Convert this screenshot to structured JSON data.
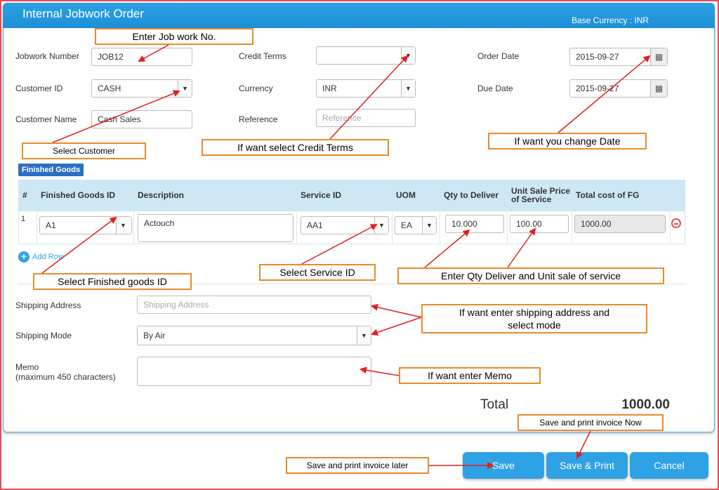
{
  "header": {
    "title": "Internal Jobwork Order",
    "base_currency": "Base Currency : INR"
  },
  "form": {
    "jobwork_number": {
      "label": "Jobwork Number",
      "value": "JOB12"
    },
    "customer_id": {
      "label": "Customer ID",
      "value": "CASH"
    },
    "customer_name": {
      "label": "Customer Name",
      "value": "Cash Sales"
    },
    "credit_terms": {
      "label": "Credit Terms",
      "value": ""
    },
    "currency": {
      "label": "Currency",
      "value": "INR"
    },
    "reference": {
      "label": "Reference",
      "placeholder": "Reference"
    },
    "order_date": {
      "label": "Order Date",
      "value": "2015-09-27"
    },
    "due_date": {
      "label": "Due Date",
      "value": "2015-09-27"
    }
  },
  "section_badge": "Finished Goods",
  "table": {
    "headers": {
      "num": "#",
      "fg_id": "Finished Goods ID",
      "description": "Description",
      "service_id": "Service ID",
      "uom": "UOM",
      "qty": "Qty to Deliver",
      "unit_price": "Unit Sale Price of Service",
      "total": "Total cost of FG"
    },
    "rows": [
      {
        "num": "1",
        "fg_id": "A1",
        "description": "Actouch",
        "service_id": "AA1",
        "uom": "EA",
        "qty": "10.000",
        "unit_price": "100.00",
        "total": "1000.00"
      }
    ],
    "add_row": "Add Row"
  },
  "shipping": {
    "address_label": "Shipping Address",
    "address_placeholder": "Shipping Address",
    "mode_label": "Shipping Mode",
    "mode_value": "By Air"
  },
  "memo": {
    "label": "Memo",
    "sublabel": "(maximum 450 characters)"
  },
  "total": {
    "label": "Total",
    "value": "1000.00"
  },
  "buttons": {
    "save": "Save",
    "save_print": "Save & Print",
    "cancel": "Cancel"
  },
  "annotations": {
    "enter_job": "Enter Job work No.",
    "select_customer": "Select Customer",
    "credit_terms": "If want select Credit Terms",
    "change_date": "If want you change Date",
    "select_fg": "Select Finished goods ID",
    "select_service": "Select Service ID",
    "qty_unit": "Enter Qty Deliver and Unit sale of service",
    "shipping_line1": "If want enter shipping address and",
    "shipping_line2": "select mode",
    "memo": "If want enter Memo",
    "print_now": "Save and print invoice Now",
    "print_later": "Save and print invoice later"
  },
  "colors": {
    "primary": "#2ea2e4",
    "annotation_border": "#ea8a2c",
    "arrow": "#e02020",
    "table_header": "#cde8f4"
  }
}
